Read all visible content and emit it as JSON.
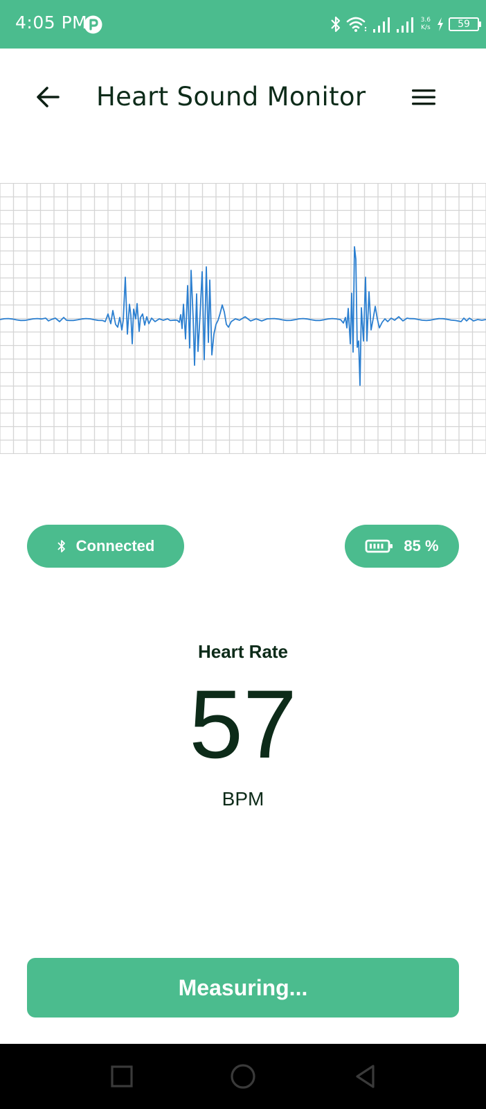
{
  "status_bar": {
    "time": "4:05 PM",
    "net_speed_value": "3.6",
    "net_speed_unit": "K/s",
    "battery_level": "59",
    "icons": [
      "app-notification-icon",
      "bluetooth-icon",
      "wifi-icon",
      "signal-1-icon",
      "signal-2-icon",
      "charging-icon",
      "battery-icon"
    ]
  },
  "header": {
    "title": "Heart Sound Monitor",
    "back_icon": "arrow-left-icon",
    "menu_icon": "hamburger-menu-icon"
  },
  "waveform": {
    "grid_color": "#d4d4d4",
    "line_color": "#2b7fd0",
    "background": "#ffffff"
  },
  "connection": {
    "label": "Connected",
    "icon": "bluetooth-icon"
  },
  "battery": {
    "label": "85 %",
    "icon": "battery-icon",
    "level": 0.85
  },
  "heart_rate": {
    "label": "Heart Rate",
    "value": "57",
    "unit": "BPM"
  },
  "action": {
    "label": "Measuring..."
  },
  "nav": {
    "icons": [
      "recent-apps-icon",
      "home-icon",
      "back-triangle-icon"
    ]
  },
  "colors": {
    "accent": "#4bbc8e",
    "text_dark": "#0d2b19",
    "nav_bar": "#000000"
  }
}
